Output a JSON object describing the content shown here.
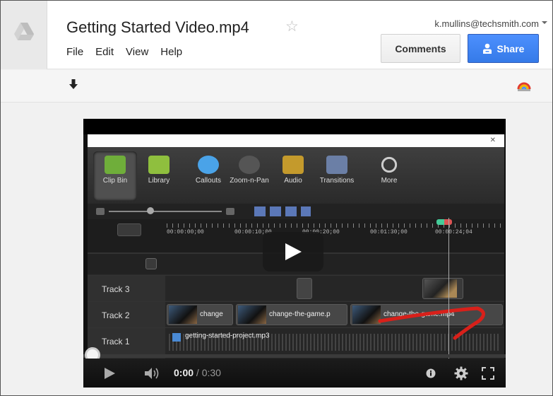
{
  "header": {
    "title": "Getting Started Video.mp4",
    "user_email": "k.mullins@techsmith.com",
    "menu": [
      "File",
      "Edit",
      "View",
      "Help"
    ],
    "comments_label": "Comments",
    "share_label": "Share"
  },
  "icons": {
    "logo": "drive-logo-icon",
    "star": "star-icon",
    "download": "download-icon",
    "open_with": "open-with-icon",
    "play": "play-icon",
    "volume": "volume-icon",
    "settings": "gear-icon",
    "fullscreen": "fullscreen-icon"
  },
  "colors": {
    "share_button": "#4d90fe",
    "comments_button": "#f3f3f3",
    "drive_logo_bg": "#e9e9e9"
  },
  "video": {
    "time_current": "0:00",
    "time_total": "0:30",
    "progress": 0,
    "content": {
      "tools": [
        "Clip Bin",
        "Library",
        "Callouts",
        "Zoom-n-Pan",
        "Audio",
        "Transitions",
        "More"
      ],
      "ruler_times": [
        "00:00:00;00",
        "00:00:10;00",
        "00:00:20;00",
        "00:01:30;00",
        "00:00:24;04"
      ],
      "tracks": [
        {
          "label": "Track 3",
          "clips": []
        },
        {
          "label": "Track 2",
          "clips": [
            "change",
            "change-the-game.p",
            "change-the-game.mp4"
          ]
        },
        {
          "label": "Track 1",
          "clips": [
            "getting-started-project.mp3"
          ]
        }
      ]
    }
  }
}
